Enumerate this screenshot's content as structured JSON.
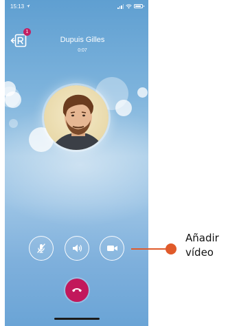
{
  "status_bar": {
    "time": "15:13"
  },
  "app": {
    "notification_badge": "1"
  },
  "call": {
    "caller_name": "Dupuis Gilles",
    "duration": "0:07"
  },
  "controls": [
    {
      "icon": "microphone-muted-icon"
    },
    {
      "icon": "speaker-icon"
    },
    {
      "icon": "video-camera-icon"
    }
  ],
  "end_call": {
    "icon": "hang-up-icon",
    "color": "#c2185b"
  },
  "annotation": {
    "line1": "Añadir",
    "line2": "vídeo",
    "color": "#e05a2a"
  }
}
